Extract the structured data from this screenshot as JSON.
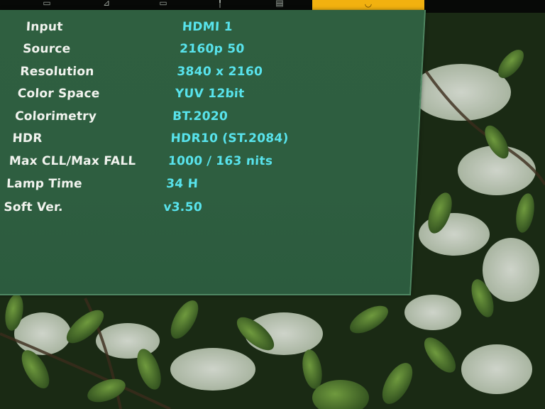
{
  "menu": {
    "tabs": [
      {
        "icon": "picture-icon"
      },
      {
        "icon": "adjust-icon"
      },
      {
        "icon": "display-icon"
      },
      {
        "icon": "setup-icon"
      },
      {
        "icon": "function-icon"
      },
      {
        "icon": "information-icon",
        "active": true
      }
    ]
  },
  "info": {
    "rows": [
      {
        "label": "Input",
        "value": "HDMI 1"
      },
      {
        "label": "Source",
        "value": "2160p 50"
      },
      {
        "label": "Resolution",
        "value": "3840 x 2160"
      },
      {
        "label": "Color Space",
        "value": "YUV 12bit"
      },
      {
        "label": "Colorimetry",
        "value": "BT.2020"
      },
      {
        "label": "HDR",
        "value": "HDR10 (ST.2084)"
      },
      {
        "label": "Max CLL/Max FALL",
        "value": "1000 / 163 nits"
      },
      {
        "label": "Lamp Time",
        "value": "34 H"
      },
      {
        "label": "Soft Ver.",
        "value": "v3.50"
      }
    ]
  },
  "colors": {
    "panel": "#2e5e40",
    "label": "#f1f3ee",
    "value": "#58e3ec",
    "active_tab": "#f2b10f"
  }
}
